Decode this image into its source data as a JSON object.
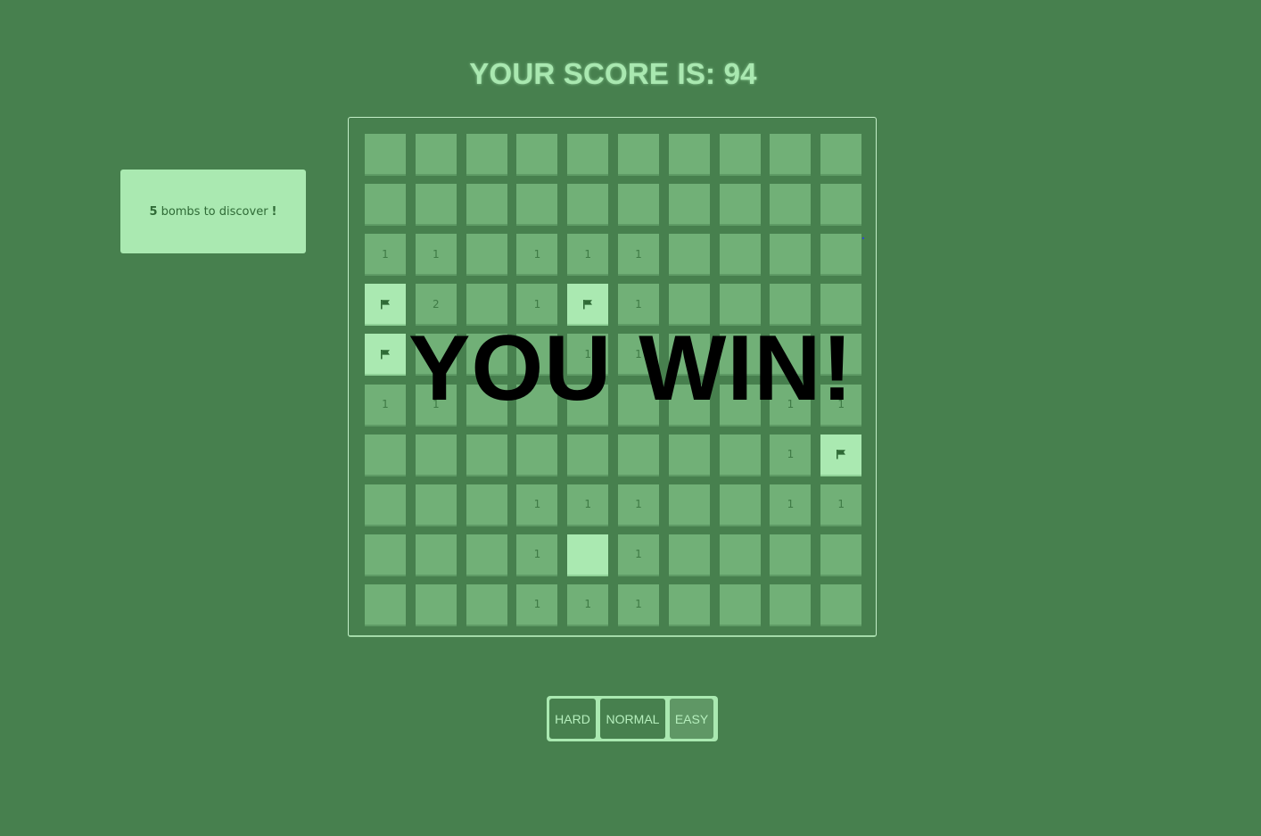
{
  "score": {
    "label": "YOUR SCORE IS: 94"
  },
  "bombs": {
    "count": "5",
    "text": "bombs to discover",
    "exclamation": "!"
  },
  "win_message": "YOU WIN!",
  "difficulty": {
    "hard": "HARD",
    "normal": "NORMAL",
    "easy": "EASY",
    "selected": "EASY"
  },
  "board": {
    "rows": 10,
    "cols": 10,
    "cells": [
      [
        "",
        "",
        "",
        "",
        "",
        "",
        "",
        "",
        "",
        ""
      ],
      [
        "",
        "",
        "",
        "",
        "",
        "",
        "",
        "",
        "",
        ""
      ],
      [
        "1",
        "1",
        "",
        "1",
        "1",
        "1",
        "",
        "",
        "",
        ""
      ],
      [
        "F",
        "2",
        "",
        "1",
        "F",
        "1",
        "",
        "",
        "",
        ""
      ],
      [
        "F",
        "",
        "",
        "",
        "1",
        "1",
        "",
        "",
        "",
        ""
      ],
      [
        "1",
        "1",
        "",
        "",
        "",
        "",
        "",
        "",
        "1",
        "1"
      ],
      [
        "",
        "",
        "",
        "",
        "",
        "",
        "",
        "",
        "1",
        "F"
      ],
      [
        "",
        "",
        "",
        "1",
        "1",
        "1",
        "",
        "",
        "1",
        "1"
      ],
      [
        "",
        "",
        "",
        "1",
        "O",
        "1",
        "",
        "",
        "",
        ""
      ],
      [
        "",
        "",
        "",
        "1",
        "1",
        "1",
        "",
        "",
        "",
        ""
      ]
    ],
    "legend": {
      "F": "flag-icon",
      "O": "opened-cell"
    }
  },
  "colors": {
    "background": "#47804e",
    "cell": "#71b077",
    "cell_open": "#aae9b1",
    "accent_text": "#a9e8b0"
  }
}
